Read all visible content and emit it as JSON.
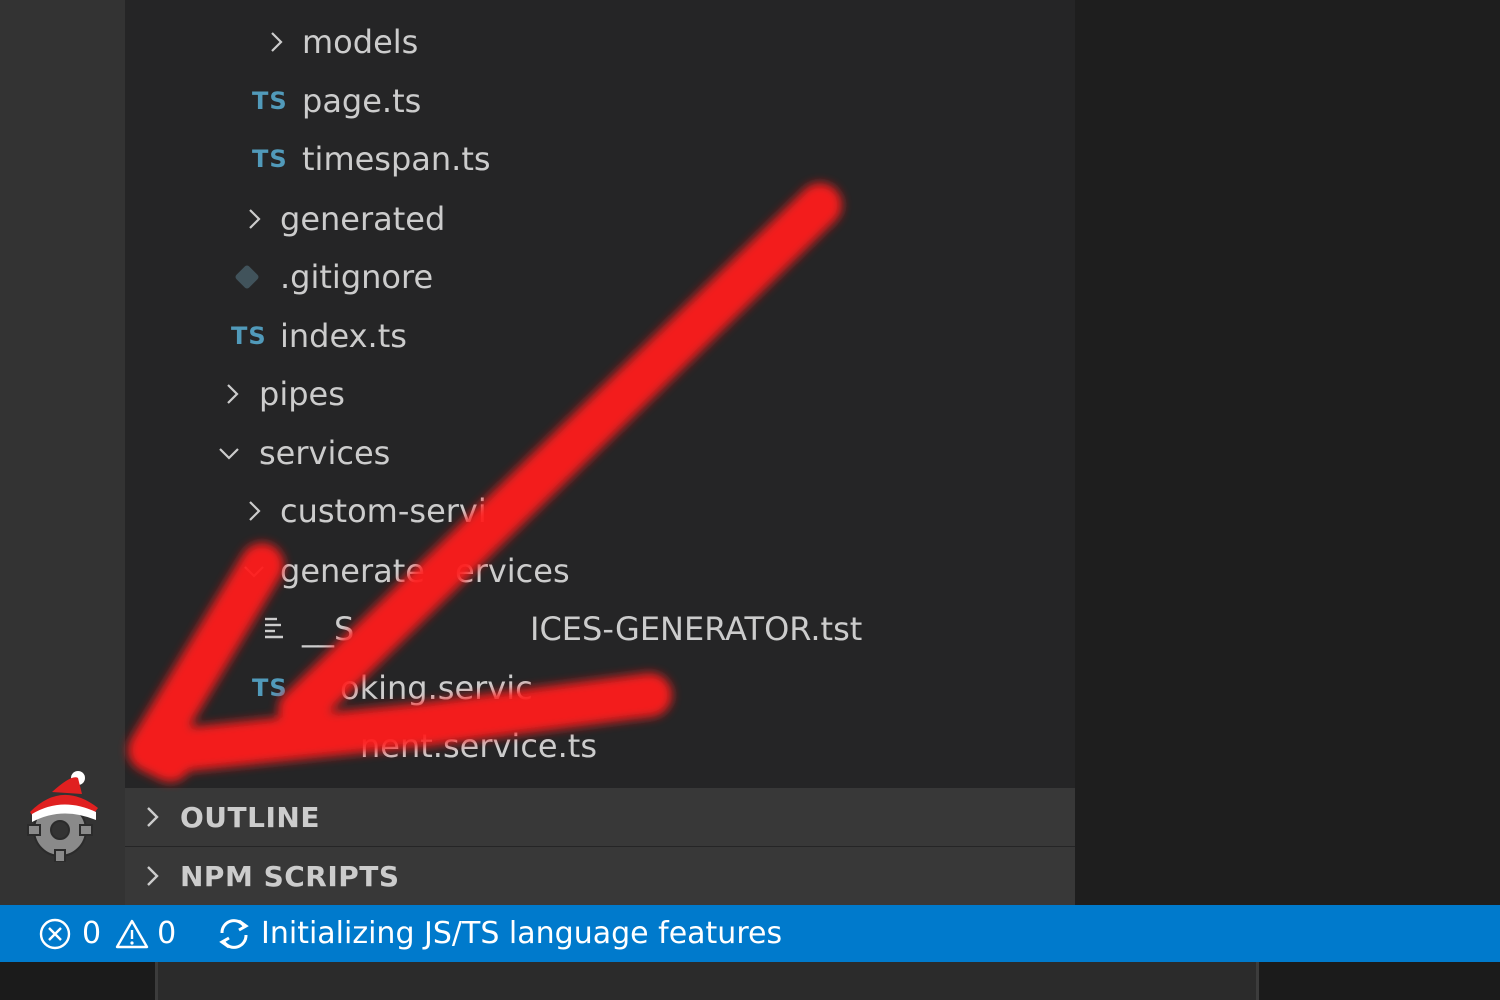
{
  "explorer": {
    "items": [
      {
        "label": "models",
        "type": "folder",
        "expanded": false
      },
      {
        "label": "page.ts",
        "type": "ts",
        "icon": "TS"
      },
      {
        "label": "timespan.ts",
        "type": "ts",
        "icon": "TS"
      },
      {
        "label": "generated",
        "type": "folder",
        "expanded": false
      },
      {
        "label": ".gitignore",
        "type": "git"
      },
      {
        "label": "index.ts",
        "type": "ts",
        "icon": "TS"
      },
      {
        "label": "pipes",
        "type": "folder",
        "expanded": false
      },
      {
        "label": "services",
        "type": "folder",
        "expanded": true
      },
      {
        "label": "custom-servi",
        "type": "folder",
        "expanded": false
      },
      {
        "label": "generate",
        "type": "folder",
        "expanded": true
      },
      {
        "label": "ervices",
        "type": "fragment"
      },
      {
        "label": "__S",
        "type": "template"
      },
      {
        "label": "ICES-GENERATOR.tst",
        "type": "fragment"
      },
      {
        "label": "oking.servic",
        "type": "ts",
        "icon": "TS"
      },
      {
        "label": "nent.service.ts",
        "type": "ts-partial"
      }
    ]
  },
  "sections": {
    "outline": "OUTLINE",
    "npm_scripts": "NPM SCRIPTS"
  },
  "status_bar": {
    "errors": "0",
    "warnings": "0",
    "message": "Initializing JS/TS language features"
  },
  "colors": {
    "status_bar": "#007acc",
    "sidebar": "#252526",
    "activity_bar": "#333333",
    "ts_icon": "#519aba",
    "annotation": "#ff1a1a"
  }
}
